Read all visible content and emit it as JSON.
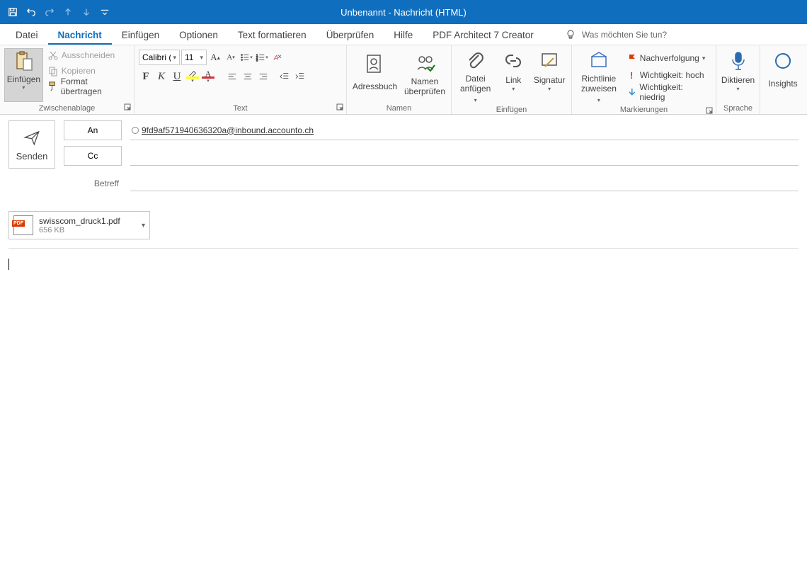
{
  "title": "Unbenannt  -  Nachricht (HTML)",
  "tabs": {
    "file": "Datei",
    "message": "Nachricht",
    "insert": "Einfügen",
    "options": "Optionen",
    "format": "Text formatieren",
    "review": "Überprüfen",
    "help": "Hilfe",
    "pdf": "PDF Architect 7 Creator"
  },
  "tell_me": "Was möchten Sie tun?",
  "clipboard": {
    "paste": "Einfügen",
    "cut": "Ausschneiden",
    "copy": "Kopieren",
    "format_painter": "Format übertragen",
    "group": "Zwischenablage"
  },
  "font": {
    "name": "Calibri (Textkörper)",
    "size": "11",
    "group": "Text"
  },
  "names": {
    "address_book": "Adressbuch",
    "check_names_1": "Namen",
    "check_names_2": "überprüfen",
    "group": "Namen"
  },
  "include": {
    "attach_file_1": "Datei",
    "attach_file_2": "anfügen",
    "link": "Link",
    "signature": "Signatur",
    "group": "Einfügen"
  },
  "tags": {
    "assign_policy_1": "Richtlinie",
    "assign_policy_2": "zuweisen",
    "follow_up": "Nachverfolgung",
    "high": "Wichtigkeit: hoch",
    "low": "Wichtigkeit: niedrig",
    "group": "Markierungen"
  },
  "voice": {
    "dictate": "Diktieren",
    "group": "Sprache"
  },
  "insights": "Insights",
  "compose": {
    "send": "Senden",
    "to": "An",
    "cc": "Cc",
    "subject": "Betreff",
    "recipient": "9fd9af571940636320a@inbound.accounto.ch"
  },
  "attachment": {
    "name": "swisscom_druck1.pdf",
    "size": "656 KB"
  }
}
